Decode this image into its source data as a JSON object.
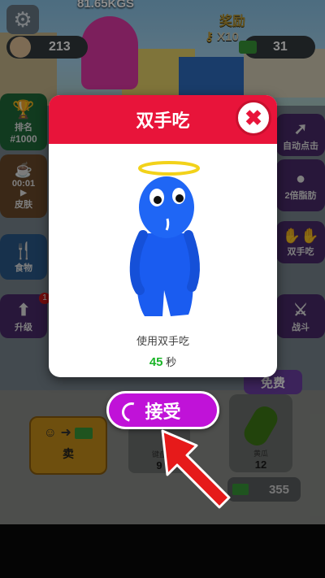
{
  "hud": {
    "weight_readout": "81.65KGS",
    "body_count": "213",
    "reward_label": "奖励",
    "key_count": "X10",
    "cash_count": "31"
  },
  "side_left": {
    "rank_label": "排名",
    "rank_value": "#1000",
    "skin_timer": "00:01",
    "skin_label": "皮肤",
    "food_label": "食物",
    "upgrade_label": "升级",
    "upgrade_badge": "1"
  },
  "side_right": {
    "auto_click_label": "自动点击",
    "double_fat_label": "2倍脂肪",
    "two_hands_label": "双手吃",
    "fight_label": "战斗"
  },
  "modal": {
    "title": "双手吃",
    "close_icon": "close-x-icon",
    "description": "使用双手吃",
    "timer_value": "45",
    "timer_unit": "秒"
  },
  "accept_button": {
    "label": "接受"
  },
  "bottom": {
    "sell_label": "卖",
    "tool_label": "键盘",
    "tool_count": "9",
    "free_label": "免费",
    "veg_label": "黄瓜",
    "veg_count": "12",
    "veg_price": "355"
  },
  "colors": {
    "modal_header": "#e8143a",
    "accept": "#c012d8",
    "timer": "#1bb528",
    "character": "#1a5cf0"
  }
}
